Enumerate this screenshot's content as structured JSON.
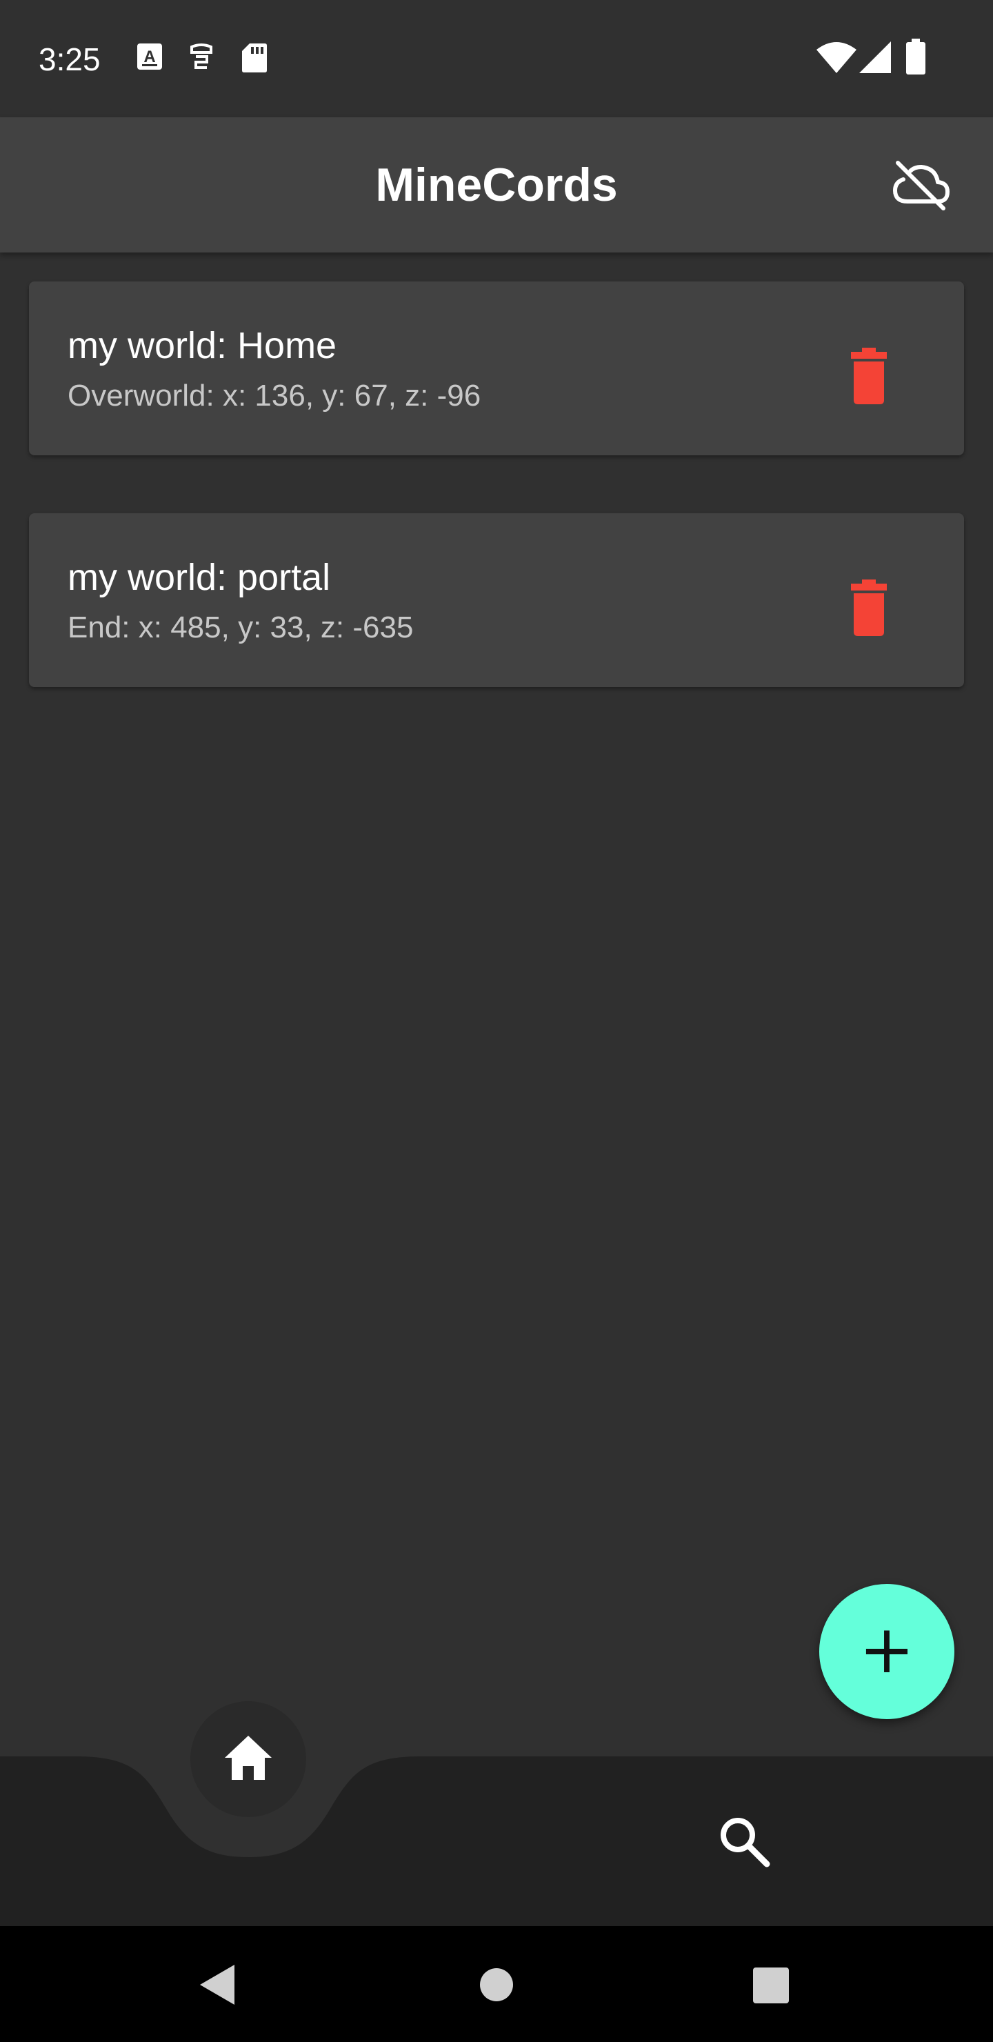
{
  "status_bar": {
    "time": "3:25",
    "left_icons": [
      "a-box-icon",
      "shield-icon",
      "sd-card-icon"
    ],
    "right_icons": [
      "wifi-icon",
      "signal-icon",
      "battery-icon"
    ]
  },
  "app_bar": {
    "title": "MineCords",
    "action_icon": "cloud-off-icon"
  },
  "entries": [
    {
      "world": "my world",
      "name": "Home",
      "dimension": "Overworld",
      "x": "136",
      "y": "67",
      "z": "-96"
    },
    {
      "world": "my world",
      "name": "portal",
      "dimension": "End",
      "x": "485",
      "y": "33",
      "z": "-635"
    }
  ],
  "fab": {
    "label": "+",
    "icon": "plus-icon"
  },
  "bottom_nav": {
    "items": [
      {
        "icon": "home-icon",
        "selected": true
      },
      {
        "icon": "search-icon",
        "selected": false
      }
    ]
  },
  "system_nav": {
    "items": [
      "back-icon",
      "home-circle-icon",
      "recents-icon"
    ]
  },
  "colors": {
    "background": "#303030",
    "app_bar": "#424242",
    "card": "#424242",
    "bottom_nav": "#212121",
    "fab": "#64ffda",
    "delete": "#f44336",
    "text_primary": "#ffffff",
    "text_secondary": "#c8c8c8"
  }
}
